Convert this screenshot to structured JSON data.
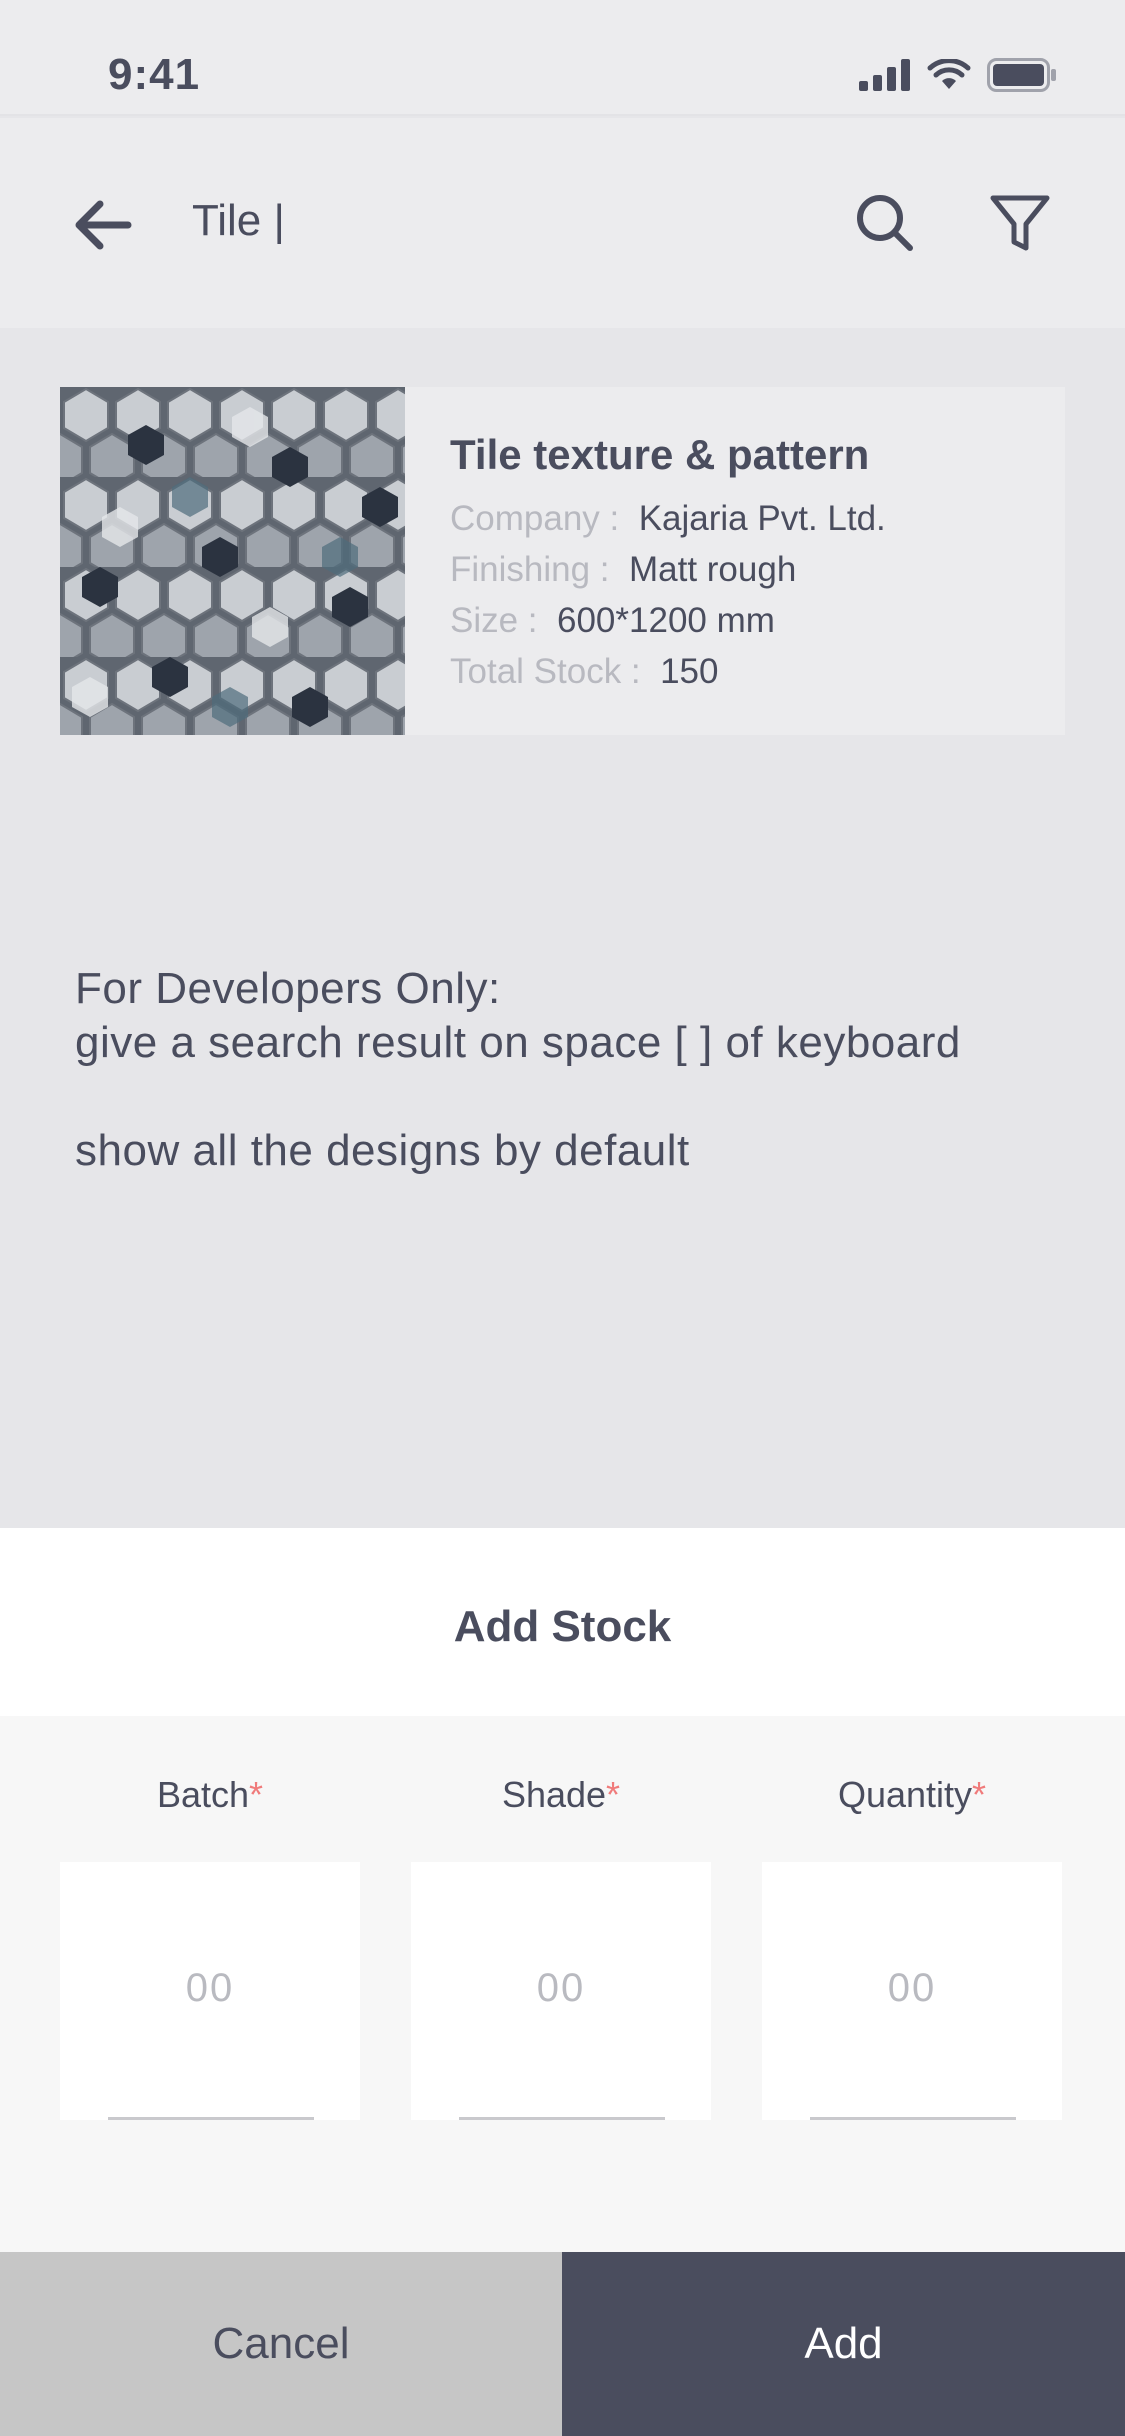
{
  "status_bar": {
    "time": "9:41",
    "icons": [
      "signal-icon",
      "wifi-icon",
      "battery-icon"
    ]
  },
  "header": {
    "search_text": "Tile |",
    "icons": [
      "back-arrow-icon",
      "search-icon",
      "filter-icon"
    ]
  },
  "product": {
    "title": "Tile texture & pattern",
    "rows": [
      {
        "label": "Company :",
        "value": "Kajaria Pvt. Ltd."
      },
      {
        "label": "Finishing :",
        "value": "Matt rough"
      },
      {
        "label": "Size :",
        "value": "600*1200 mm"
      },
      {
        "label": "Total Stock :",
        "value": "150"
      }
    ]
  },
  "dev_note": {
    "line1": "For Developers Only:",
    "line2": "give a search result on space [ ] of keyboard",
    "line3": "show all the designs by default"
  },
  "sheet": {
    "title": "Add Stock",
    "fields": [
      {
        "label": "Batch",
        "required_mark": "*",
        "value": "00"
      },
      {
        "label": "Shade",
        "required_mark": "*",
        "value": "00"
      },
      {
        "label": "Quantity",
        "required_mark": "*",
        "value": "00"
      }
    ],
    "cancel_label": "Cancel",
    "add_label": "Add"
  },
  "colors": {
    "primary": "#4a4d5e",
    "required": "#f07b7b",
    "cancel_bg": "#c6c6c6"
  }
}
